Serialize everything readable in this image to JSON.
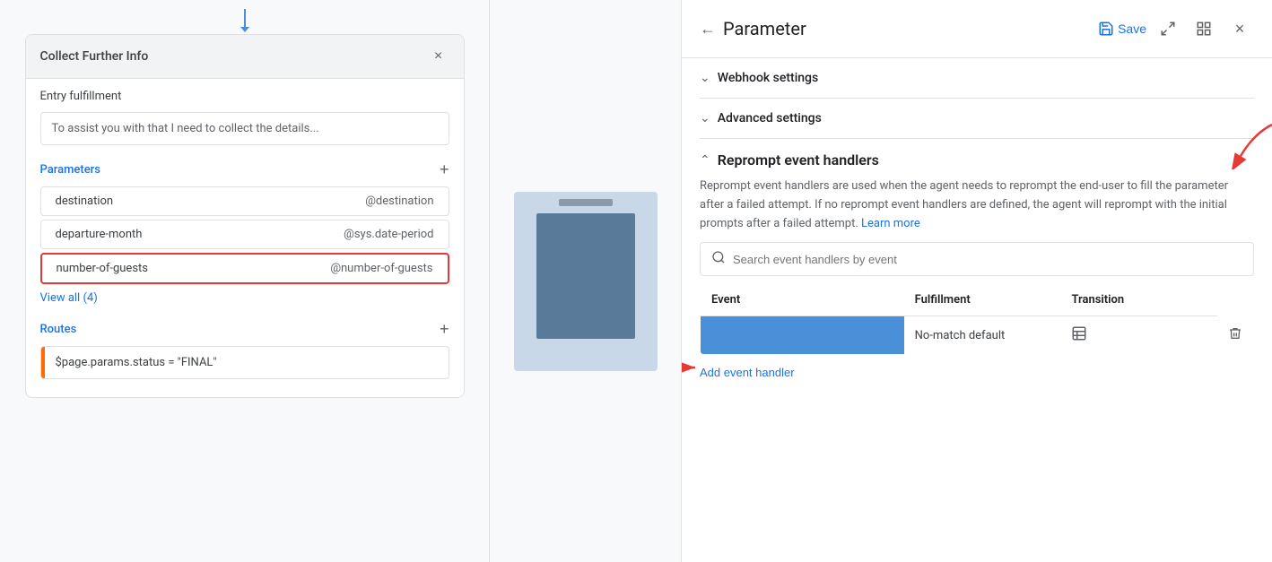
{
  "leftPanel": {
    "connectorVisible": true,
    "card": {
      "title": "Collect Further Info",
      "closeBtn": "×",
      "entryFulfillment": {
        "label": "Entry fulfillment",
        "text": "To assist you with that I need to collect the details..."
      },
      "parameters": {
        "label": "Parameters",
        "addBtn": "+",
        "rows": [
          {
            "name": "destination",
            "value": "@destination"
          },
          {
            "name": "departure-month",
            "value": "@sys.date-period"
          },
          {
            "name": "number-of-guests",
            "value": "@number-of-guests",
            "selected": true
          }
        ],
        "viewAll": "View all (4)"
      },
      "routes": {
        "label": "Routes",
        "addBtn": "+",
        "rows": [
          {
            "text": "$page.params.status = \"FINAL\""
          }
        ]
      }
    }
  },
  "middlePanel": {
    "visible": true
  },
  "rightPanel": {
    "header": {
      "backIcon": "←",
      "title": "Parameter",
      "saveLabel": "Save",
      "expandIcon": "⛶",
      "gridIcon": "⊞",
      "closeIcon": "×"
    },
    "webhookSettings": {
      "label": "Webhook settings"
    },
    "advancedSettings": {
      "label": "Advanced settings"
    },
    "reprompt": {
      "title": "Reprompt event handlers",
      "description": "Reprompt event handlers are used when the agent needs to reprompt the end-user to fill the parameter after a failed attempt. If no reprompt event handlers are defined, the agent will reprompt with the initial prompts after a failed attempt.",
      "learnMore": "Learn more",
      "search": {
        "placeholder": "Search event handlers by event"
      },
      "table": {
        "columns": [
          "Event",
          "Fulfillment",
          "Transition"
        ],
        "rows": [
          {
            "event": "No-match default",
            "fulfillment": "📋",
            "transition": ""
          }
        ]
      },
      "addHandler": "Add event handler"
    }
  }
}
